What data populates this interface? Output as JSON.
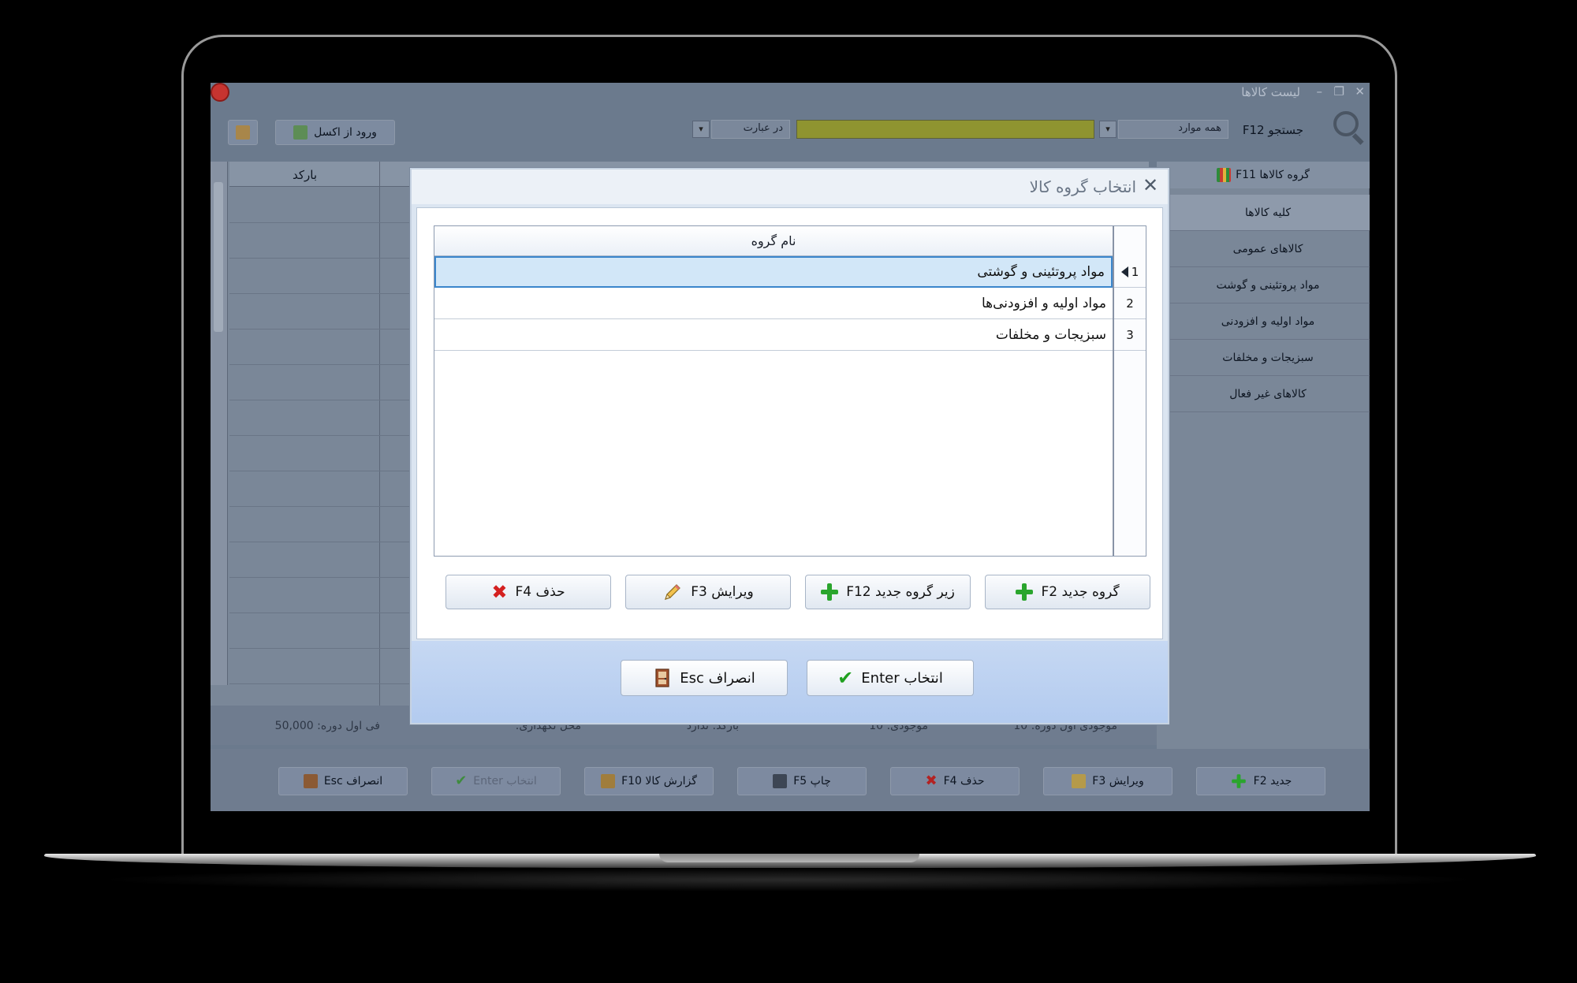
{
  "app": {
    "title": "لیست کالاها",
    "window_controls": {
      "minimize": "–",
      "restore": "❐",
      "close": "✕"
    }
  },
  "toolbar": {
    "excel_import_label": "ورود از اکسل",
    "search_label": "جستجو F12",
    "search_scope": "همه موارد",
    "search_mode": "در عبارت",
    "search_value": "",
    "combo_arrow": "▾"
  },
  "grid": {
    "columns": [
      "بارکد"
    ]
  },
  "categories": {
    "header": "گروه کالاها F11",
    "items": [
      "کلیه کالاها",
      "کالاهای عمومی",
      "مواد پروتئینی و گوشت",
      "مواد اولیه و افزودنی",
      "سبزیجات و مخلفات",
      "کالاهای غیر فعال"
    ],
    "active_index": 0
  },
  "status": {
    "initial_stock": "موجودی اول دوره: 10",
    "stock": "موجودی: 10",
    "barcode": "بارکد: ندارد",
    "storage_location": "محل نگهداری:",
    "initial_price": "فی اول دوره: 50,000"
  },
  "footer": {
    "new": "جدید F2",
    "edit": "ویرایش F3",
    "delete": "حذف F4",
    "print": "چاپ F5",
    "report": "گزارش کالا F10",
    "select": "انتخاب Enter",
    "cancel": "انصراف Esc"
  },
  "dialog": {
    "title": "انتخاب گروه کالا",
    "close_glyph": "✕",
    "table_header": "نام گروه",
    "rows": [
      {
        "num": "1",
        "name": "مواد پروتئینی و گوشتی"
      },
      {
        "num": "2",
        "name": "مواد اولیه و افزودنی‌ها"
      },
      {
        "num": "3",
        "name": "سبزیجات و مخلفات"
      }
    ],
    "selected_row": 0,
    "buttons": {
      "new_group": "گروه جدید F2",
      "new_subgroup": "زیر گروه جدید F12",
      "edit": "ویرایش F3",
      "delete": "حذف F4",
      "select": "انتخاب Enter",
      "cancel": "انصراف Esc"
    },
    "glyphs": {
      "x": "✖",
      "check": "✔"
    }
  },
  "colors": {
    "accent_green": "#2aa52d",
    "delete_red": "#d42020",
    "selection_blue": "#3b86cc",
    "search_highlight": "#8f9430"
  }
}
